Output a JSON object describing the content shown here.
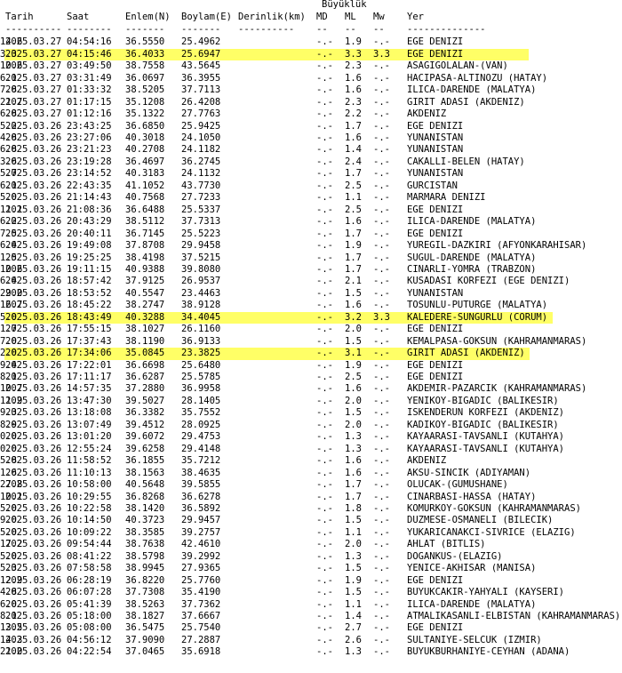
{
  "header": {
    "group_title": "Büyüklük",
    "columns": {
      "date": "Tarih",
      "time": "Saat",
      "lat": "Enlem(N)",
      "lon": "Boylam(E)",
      "depth": "Derinlik(km)",
      "md": "MD",
      "ml": "ML",
      "mw": "Mw",
      "loc": "Yer"
    },
    "dashes": {
      "date": "----------",
      "time": "--------",
      "lat": "-------",
      "lon": "-------",
      "depth": "----------",
      "md": "--",
      "ml": "--",
      "mw": "--",
      "loc": "--------------"
    }
  },
  "highlight_color": "#ffff66",
  "rows": [
    {
      "date": "2025.03.27",
      "time": "04:54:16",
      "lat": "36.5550",
      "lon": "25.4962",
      "depth": "14.6",
      "md": "-.-",
      "ml": "1.9",
      "mw": "-.-",
      "loc": "EGE DENIZI",
      "hl": false
    },
    {
      "date": "2025.03.27",
      "time": "04:15:46",
      "lat": "36.4033",
      "lon": "25.6947",
      "depth": "3.3",
      "md": "-.-",
      "ml": "3.3",
      "mw": "3.3",
      "loc": "EGE DENIZI",
      "hl": true
    },
    {
      "date": "2025.03.27",
      "time": "03:49:50",
      "lat": "38.7558",
      "lon": "43.5645",
      "depth": "10.6",
      "md": "-.-",
      "ml": "2.3",
      "mw": "-.-",
      "loc": "ASAGIGOLALAN-(VAN)",
      "hl": false
    },
    {
      "date": "2025.03.27",
      "time": "03:31:49",
      "lon": "36.3955",
      "lat": "36.0697",
      "depth": "6.1",
      "md": "-.-",
      "ml": "1.6",
      "mw": "-.-",
      "loc": "HACIPASA-ALTINOZU (HATAY)",
      "hl": false
    },
    {
      "date": "2025.03.27",
      "time": "01:33:32",
      "lat": "38.5205",
      "lon": "37.7113",
      "depth": "7.8",
      "md": "-.-",
      "ml": "1.6",
      "mw": "-.-",
      "loc": "ILICA-DARENDE (MALATYA)",
      "hl": false
    },
    {
      "date": "2025.03.27",
      "time": "01:17:15",
      "lat": "35.1208",
      "lon": "26.4208",
      "depth": "21.7",
      "md": "-.-",
      "ml": "2.3",
      "mw": "-.-",
      "loc": "GIRIT ADASI (AKDENIZ)",
      "hl": false
    },
    {
      "date": "2025.03.27",
      "time": "01:12:16",
      "lat": "35.1322",
      "lon": "27.7763",
      "depth": "6.8",
      "md": "-.-",
      "ml": "2.2",
      "mw": "-.-",
      "loc": "AKDENIZ",
      "hl": false
    },
    {
      "date": "2025.03.26",
      "time": "23:43:25",
      "lat": "36.6850",
      "lon": "25.9425",
      "depth": "5.2",
      "md": "-.-",
      "ml": "1.7",
      "mw": "-.-",
      "loc": "EGE DENIZI",
      "hl": false
    },
    {
      "date": "2025.03.26",
      "time": "23:27:06",
      "lat": "40.3018",
      "lon": "24.1050",
      "depth": "4.8",
      "md": "-.-",
      "ml": "1.6",
      "mw": "-.-",
      "loc": "YUNANISTAN",
      "hl": false
    },
    {
      "date": "2025.03.26",
      "time": "23:21:23",
      "lat": "40.2708",
      "lon": "24.1182",
      "depth": "6.8",
      "md": "-.-",
      "ml": "1.4",
      "mw": "-.-",
      "loc": "YUNANISTAN",
      "hl": false
    },
    {
      "date": "2025.03.26",
      "time": "23:19:28",
      "lat": "36.4697",
      "lon": "36.2745",
      "depth": "3.6",
      "md": "-.-",
      "ml": "2.4",
      "mw": "-.-",
      "loc": "CAKALLI-BELEN (HATAY)",
      "hl": false
    },
    {
      "date": "2025.03.26",
      "time": "23:14:52",
      "lat": "40.3183",
      "lon": "24.1132",
      "depth": "5.7",
      "md": "-.-",
      "ml": "1.7",
      "mw": "-.-",
      "loc": "YUNANISTAN",
      "hl": false
    },
    {
      "date": "2025.03.26",
      "time": "22:43:35",
      "lat": "41.1052",
      "lon": "43.7730",
      "depth": "6.1",
      "md": "-.-",
      "ml": "2.5",
      "mw": "-.-",
      "loc": "GURCISTAN",
      "hl": false
    },
    {
      "date": "2025.03.26",
      "time": "21:14:43",
      "lat": "40.7568",
      "lon": "27.7233",
      "depth": "5.0",
      "md": "-.-",
      "ml": "1.1",
      "mw": "-.-",
      "loc": "MARMARA DENIZI",
      "hl": false
    },
    {
      "date": "2025.03.26",
      "time": "21:08:36",
      "lat": "36.6488",
      "lon": "25.5337",
      "depth": "11.1",
      "md": "-.-",
      "ml": "2.5",
      "mw": "-.-",
      "loc": "EGE DENIZI",
      "hl": false
    },
    {
      "date": "2025.03.26",
      "time": "20:43:29",
      "lat": "38.5112",
      "lon": "37.7313",
      "depth": "6.2",
      "md": "-.-",
      "ml": "1.6",
      "mw": "-.-",
      "loc": "ILICA-DARENDE (MALATYA)",
      "hl": false
    },
    {
      "date": "2025.03.26",
      "time": "20:40:11",
      "lat": "36.7145",
      "lon": "25.5223",
      "depth": "7.5",
      "md": "-.-",
      "ml": "1.7",
      "mw": "-.-",
      "loc": "EGE DENIZI",
      "hl": false
    },
    {
      "date": "2025.03.26",
      "time": "19:49:08",
      "lat": "37.8708",
      "lon": "29.9458",
      "depth": "6.4",
      "md": "-.-",
      "ml": "1.9",
      "mw": "-.-",
      "loc": "YUREGIL-DAZKIRI (AFYONKARAHISAR)",
      "hl": false
    },
    {
      "date": "2025.03.26",
      "time": "19:25:25",
      "lat": "38.4198",
      "lon": "37.5215",
      "depth": "1.5",
      "md": "-.-",
      "ml": "1.7",
      "mw": "-.-",
      "loc": "SUGUL-DARENDE (MALATYA)",
      "hl": false
    },
    {
      "date": "2025.03.26",
      "time": "19:11:15",
      "lat": "40.9388",
      "lon": "39.8080",
      "depth": "10.6",
      "md": "-.-",
      "ml": "1.7",
      "mw": "-.-",
      "loc": "CINARLI-YOMRA (TRABZON)",
      "hl": false
    },
    {
      "date": "2025.03.26",
      "time": "18:57:42",
      "lat": "37.9125",
      "lon": "26.9537",
      "depth": "6.4",
      "md": "-.-",
      "ml": "2.1",
      "mw": "-.-",
      "loc": "KUSADASI KORFEZI (EGE DENIZI)",
      "hl": false
    },
    {
      "date": "2025.03.26",
      "time": "18:53:52",
      "lat": "40.5547",
      "lon": "23.4463",
      "depth": "29.0",
      "md": "-.-",
      "ml": "1.5",
      "mw": "-.-",
      "loc": "YUNANISTAN",
      "hl": false
    },
    {
      "date": "2025.03.26",
      "time": "18:45:22",
      "lat": "38.2747",
      "lon": "38.9128",
      "depth": "16.7",
      "md": "-.-",
      "ml": "1.6",
      "mw": "-.-",
      "loc": "TOSUNLU-PUTURGE (MALATYA)",
      "hl": false
    },
    {
      "date": "2025.03.26",
      "time": "18:43:49",
      "lat": "40.3288",
      "lon": "34.4045",
      "depth": "5.0",
      "md": "-.-",
      "ml": "3.2",
      "mw": "3.3",
      "loc": "KALEDERE-SUNGURLU (CORUM)",
      "hl": true
    },
    {
      "date": "2025.03.26",
      "time": "17:55:15",
      "lat": "38.1027",
      "lon": "26.1160",
      "depth": "1.7",
      "md": "-.-",
      "ml": "2.0",
      "mw": "-.-",
      "loc": "EGE DENIZI",
      "hl": false
    },
    {
      "date": "2025.03.26",
      "time": "17:37:43",
      "lat": "38.1190",
      "lon": "36.9133",
      "depth": "7.0",
      "md": "-.-",
      "ml": "1.5",
      "mw": "-.-",
      "loc": "KEMALPASA-GOKSUN (KAHRAMANMARAS)",
      "hl": false
    },
    {
      "date": "2025.03.26",
      "time": "17:34:06",
      "lat": "35.0845",
      "lon": "23.3825",
      "depth": "2.0",
      "md": "-.-",
      "ml": "3.1",
      "mw": "-.-",
      "loc": "GIRIT ADASI (AKDENIZ)",
      "hl": true
    },
    {
      "date": "2025.03.26",
      "time": "17:22:01",
      "lat": "36.6698",
      "lon": "25.6480",
      "depth": "9.4",
      "md": "-.-",
      "ml": "1.9",
      "mw": "-.-",
      "loc": "EGE DENIZI",
      "hl": false
    },
    {
      "date": "2025.03.26",
      "time": "17:11:17",
      "lat": "36.6287",
      "lon": "25.5785",
      "depth": "8.1",
      "md": "-.-",
      "ml": "2.5",
      "mw": "-.-",
      "loc": "EGE DENIZI",
      "hl": false
    },
    {
      "date": "2025.03.26",
      "time": "14:57:35",
      "lat": "37.2880",
      "lon": "36.9958",
      "depth": "10.7",
      "md": "-.-",
      "ml": "1.6",
      "mw": "-.-",
      "loc": "AKDEMIR-PAZARCIK (KAHRAMANMARAS)",
      "hl": false
    },
    {
      "date": "2025.03.26",
      "time": "13:47:30",
      "lat": "39.5027",
      "lon": "28.1405",
      "depth": "11.9",
      "md": "-.-",
      "ml": "2.0",
      "mw": "-.-",
      "loc": "YENIKOY-BIGADIC (BALIKESIR)",
      "hl": false
    },
    {
      "date": "2025.03.26",
      "time": "13:18:08",
      "lat": "36.3382",
      "lon": "35.7552",
      "depth": "9.3",
      "md": "-.-",
      "ml": "1.5",
      "mw": "-.-",
      "loc": "ISKENDERUN KORFEZI (AKDENIZ)",
      "hl": false
    },
    {
      "date": "2025.03.26",
      "time": "13:07:49",
      "lat": "39.4512",
      "lon": "28.0925",
      "depth": "8.9",
      "md": "-.-",
      "ml": "2.0",
      "mw": "-.-",
      "loc": "KADIKOY-BIGADIC (BALIKESIR)",
      "hl": false
    },
    {
      "date": "2025.03.26",
      "time": "13:01:20",
      "lat": "39.6072",
      "lon": "29.4753",
      "depth": "0.0",
      "md": "-.-",
      "ml": "1.3",
      "mw": "-.-",
      "loc": "KAYAARASI-TAVSANLI (KUTAHYA)",
      "hl": false
    },
    {
      "date": "2025.03.26",
      "time": "12:55:24",
      "lat": "39.6258",
      "lon": "29.4148",
      "depth": "0.0",
      "md": "-.-",
      "ml": "1.3",
      "mw": "-.-",
      "loc": "KAYAARASI-TAVSANLI (KUTAHYA)",
      "hl": false
    },
    {
      "date": "2025.03.26",
      "time": "11:58:52",
      "lat": "36.1855",
      "lon": "35.7212",
      "depth": "5.8",
      "md": "-.-",
      "ml": "1.6",
      "mw": "-.-",
      "loc": "AKDENIZ",
      "hl": false
    },
    {
      "date": "2025.03.26",
      "time": "11:10:13",
      "lat": "38.1563",
      "lon": "38.4635",
      "depth": "1.6",
      "md": "-.-",
      "ml": "1.6",
      "mw": "-.-",
      "loc": "AKSU-SINCIK (ADIYAMAN)",
      "hl": false
    },
    {
      "date": "2025.03.26",
      "time": "10:58:00",
      "lat": "40.5648",
      "lon": "39.5855",
      "depth": "27.8",
      "md": "-.-",
      "ml": "1.7",
      "mw": "-.-",
      "loc": "OLUCAK-(GUMUSHANE)",
      "hl": false
    },
    {
      "date": "2025.03.26",
      "time": "10:29:55",
      "lat": "36.8268",
      "lon": "36.6278",
      "depth": "10.1",
      "md": "-.-",
      "ml": "1.7",
      "mw": "-.-",
      "loc": "CINARBASI-HASSA (HATAY)",
      "hl": false
    },
    {
      "date": "2025.03.26",
      "time": "10:22:58",
      "lat": "38.1420",
      "lon": "36.5892",
      "depth": "5.0",
      "md": "-.-",
      "ml": "1.8",
      "mw": "-.-",
      "loc": "KOMURKOY-GOKSUN (KAHRAMANMARAS)",
      "hl": false
    },
    {
      "date": "2025.03.26",
      "time": "10:14:50",
      "lat": "40.3723",
      "lon": "29.9457",
      "depth": "9.0",
      "md": "-.-",
      "ml": "1.5",
      "mw": "-.-",
      "loc": "DUZMESE-OSMANELI (BILECIK)",
      "hl": false
    },
    {
      "date": "2025.03.26",
      "time": "10:09:22",
      "lat": "38.3585",
      "lon": "39.2757",
      "depth": "5.0",
      "md": "-.-",
      "ml": "1.1",
      "mw": "-.-",
      "loc": "YUKARICANAKCI-SIVRICE (ELAZIG)",
      "hl": false
    },
    {
      "date": "2025.03.26",
      "time": "09:54:44",
      "lat": "38.7638",
      "lon": "42.4610",
      "depth": "17.2",
      "md": "-.-",
      "ml": "2.0",
      "mw": "-.-",
      "loc": "AHLAT (BITLIS)",
      "hl": false
    },
    {
      "date": "2025.03.26",
      "time": "08:41:22",
      "lat": "38.5798",
      "lon": "39.2992",
      "depth": "5.0",
      "md": "-.-",
      "ml": "1.3",
      "mw": "-.-",
      "loc": "DOGANKUS-(ELAZIG)",
      "hl": false
    },
    {
      "date": "2025.03.26",
      "time": "07:58:58",
      "lat": "38.9945",
      "lon": "27.9365",
      "depth": "5.3",
      "md": "-.-",
      "ml": "1.5",
      "mw": "-.-",
      "loc": "YENICE-AKHISAR (MANISA)",
      "hl": false
    },
    {
      "date": "2025.03.26",
      "time": "06:28:19",
      "lat": "36.8220",
      "lon": "25.7760",
      "depth": "12.9",
      "md": "-.-",
      "ml": "1.9",
      "mw": "-.-",
      "loc": "EGE DENIZI",
      "hl": false
    },
    {
      "date": "2025.03.26",
      "time": "06:07:28",
      "lat": "37.7308",
      "lon": "35.4190",
      "depth": "4.8",
      "md": "-.-",
      "ml": "1.5",
      "mw": "-.-",
      "loc": "BUYUKCAKIR-YAHYALI (KAYSERI)",
      "hl": false
    },
    {
      "date": "2025.03.26",
      "time": "05:41:39",
      "lat": "38.5263",
      "lon": "37.7362",
      "depth": "6.0",
      "md": "-.-",
      "ml": "1.1",
      "mw": "-.-",
      "loc": "ILICA-DARENDE (MALATYA)",
      "hl": false
    },
    {
      "date": "2025.03.26",
      "time": "05:18:00",
      "lat": "38.1827",
      "lon": "37.6667",
      "depth": "8.1",
      "md": "-.-",
      "ml": "1.4",
      "mw": "-.-",
      "loc": "ATMALIKASANLI-ELBISTAN (KAHRAMANMARAS)",
      "hl": false
    },
    {
      "date": "2025.03.26",
      "time": "05:08:00",
      "lat": "36.5475",
      "lon": "25.7540",
      "depth": "13.5",
      "md": "-.-",
      "ml": "2.7",
      "mw": "-.-",
      "loc": "EGE DENIZI",
      "hl": false
    },
    {
      "date": "2025.03.26",
      "time": "04:56:12",
      "lat": "37.9090",
      "lon": "27.2887",
      "depth": "14.3",
      "md": "-.-",
      "ml": "2.6",
      "mw": "-.-",
      "loc": "SULTANIYE-SELCUK (IZMIR)",
      "hl": false
    },
    {
      "date": "2025.03.26",
      "time": "04:22:54",
      "lat": "37.0465",
      "lon": "35.6918",
      "depth": "21.0",
      "md": "-.-",
      "ml": "1.3",
      "mw": "-.-",
      "loc": "BUYUKBURHANIYE-CEYHAN (ADANA)",
      "hl": false
    }
  ]
}
